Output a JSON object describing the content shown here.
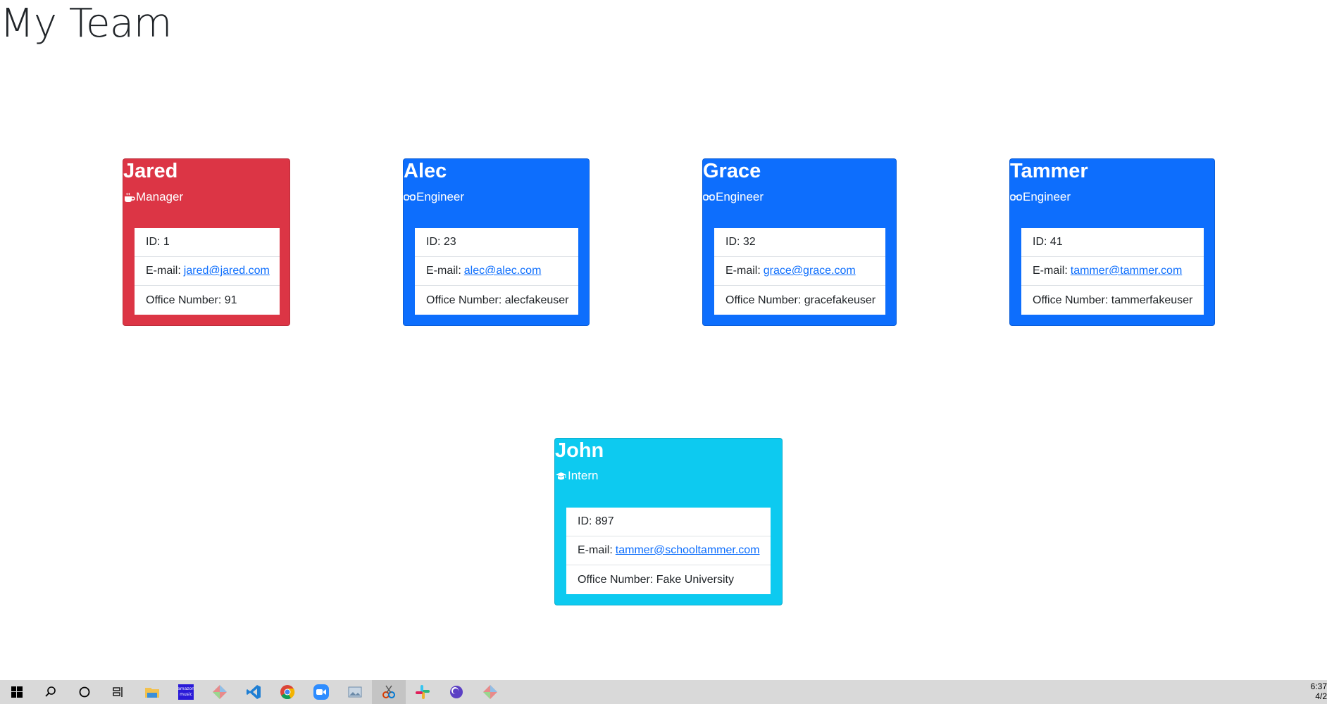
{
  "page": {
    "title": "My Team"
  },
  "colors": {
    "manager": "#dc3545",
    "engineer": "#0d6efd",
    "intern": "#0dcaf0"
  },
  "team": [
    {
      "name": "Jared",
      "role": "Manager",
      "icon": "coffee-icon",
      "id_text": "ID: 1",
      "email_prefix": "E-mail:",
      "email": "jared@jared.com",
      "extra_text": "Office Number: 91"
    },
    {
      "name": "Alec",
      "role": "Engineer",
      "icon": "glasses-icon",
      "id_text": "ID: 23",
      "email_prefix": "E-mail:",
      "email": "alec@alec.com",
      "extra_text": "Office Number: alecfakeuser"
    },
    {
      "name": "Grace",
      "role": "Engineer",
      "icon": "glasses-icon",
      "id_text": "ID: 32",
      "email_prefix": "E-mail:",
      "email": "grace@grace.com",
      "extra_text": "Office Number: gracefakeuser"
    },
    {
      "name": "Tammer",
      "role": "Engineer",
      "icon": "glasses-icon",
      "id_text": "ID: 41",
      "email_prefix": "E-mail:",
      "email": "tammer@tammer.com",
      "extra_text": "Office Number: tammerfakeuser"
    },
    {
      "name": "John",
      "role": "Intern",
      "icon": "graduation-cap-icon",
      "id_text": "ID: 897",
      "email_prefix": "E-mail:",
      "email": "tammer@schooltammer.com",
      "extra_text": "Office Number: Fake University"
    }
  ],
  "taskbar": {
    "icons": [
      "windows-start-icon",
      "search-icon",
      "cortana-icon",
      "task-view-icon",
      "file-explorer-icon",
      "amazon-music-icon",
      "app-icon",
      "vscode-icon",
      "chrome-icon",
      "zoom-icon",
      "photos-icon",
      "snipping-tool-icon",
      "slack-icon",
      "app-icon",
      "app-icon"
    ],
    "amazon_label": "amazon music",
    "clock_time": "6:37",
    "clock_date": "4/2"
  }
}
